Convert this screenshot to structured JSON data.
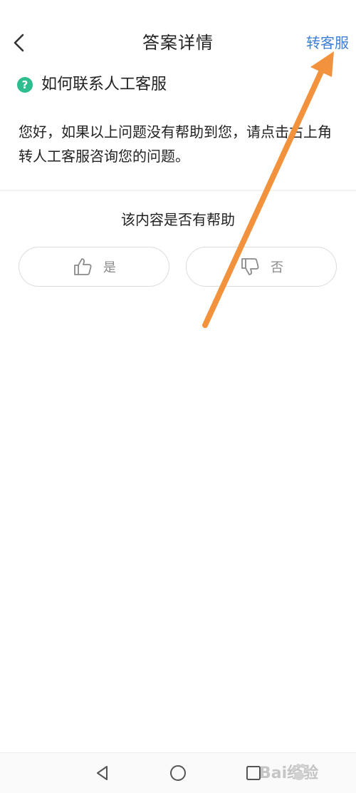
{
  "header": {
    "title": "答案详情",
    "back_icon": "chevron-left-icon",
    "transfer_label": "转客服"
  },
  "question": {
    "icon": "question-circle-icon",
    "icon_glyph": "?",
    "title": "如何联系人工客服"
  },
  "answer": {
    "text": "您好，如果以上问题没有帮助到您，请点击右上角转人工客服咨询您的问题。"
  },
  "feedback": {
    "title": "该内容是否有帮助",
    "yes_label": "是",
    "yes_icon": "thumbs-up-icon",
    "no_label": "否",
    "no_icon": "thumbs-down-icon"
  },
  "nav_bar": {
    "back_icon": "triangle-back-icon",
    "home_icon": "circle-home-icon",
    "recent_icon": "square-recent-icon"
  },
  "watermark": {
    "text": "Bai经验",
    "icon": "baidu-paw-icon"
  },
  "colors": {
    "accent_blue": "#3d7fd6",
    "question_green": "#2ebd8f",
    "annotation_orange": "#f3923d",
    "icon_gray": "#8a8a8a"
  }
}
